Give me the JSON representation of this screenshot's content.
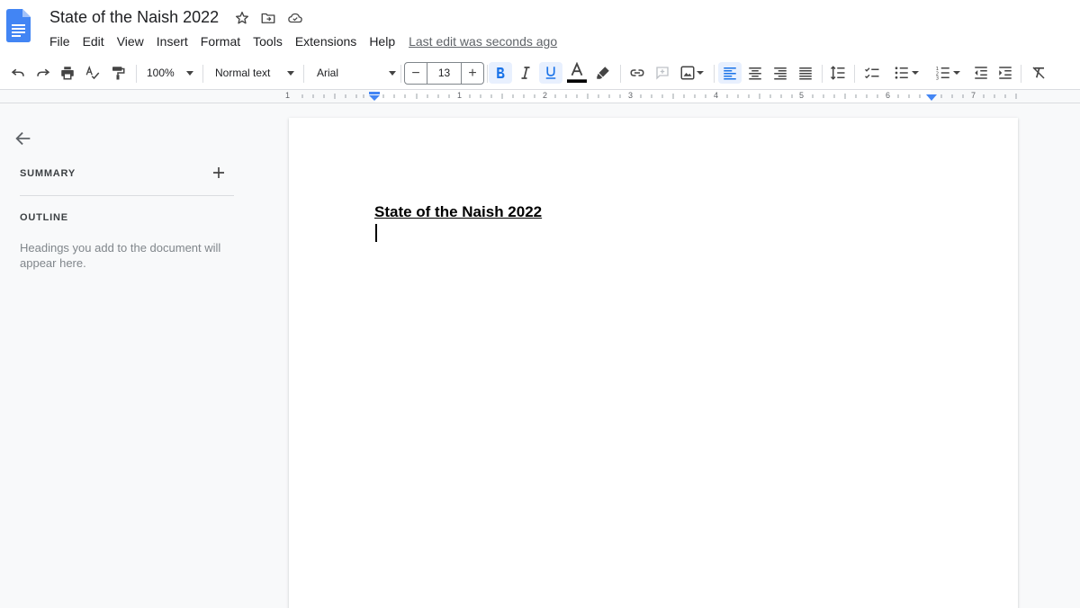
{
  "title": "State of the Naish 2022",
  "menu": [
    "File",
    "Edit",
    "View",
    "Insert",
    "Format",
    "Tools",
    "Extensions",
    "Help"
  ],
  "last_edit": "Last edit was seconds ago",
  "toolbar": {
    "zoom": "100%",
    "style": "Normal text",
    "font": "Arial",
    "font_size": "13",
    "decrease": "−",
    "increase": "+",
    "text_color": "#000000",
    "accent": "#1a73e8"
  },
  "ruler": {
    "numbers": [
      "1",
      "1",
      "2",
      "3",
      "4",
      "5",
      "6",
      "7"
    ]
  },
  "sidebar": {
    "summary": "SUMMARY",
    "outline": "OUTLINE",
    "hint": "Headings you add to the document will appear here."
  },
  "document": {
    "heading": "State of the Naish 2022"
  }
}
